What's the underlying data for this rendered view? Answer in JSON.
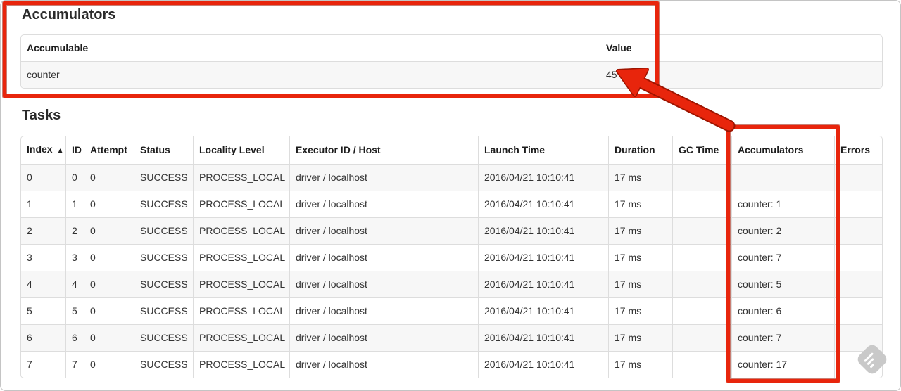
{
  "colors": {
    "annotation_red": "#e8250c",
    "annotation_red_dark": "#9e1400",
    "table_border": "#dddddd",
    "row_stripe": "#f7f7f7",
    "text": "#333333"
  },
  "accumulators_section": {
    "heading": "Accumulators",
    "table": {
      "columns": [
        "Accumulable",
        "Value"
      ],
      "rows": [
        [
          "counter",
          "45"
        ]
      ]
    }
  },
  "tasks_section": {
    "heading": "Tasks",
    "table": {
      "columns": [
        "Index",
        "ID",
        "Attempt",
        "Status",
        "Locality Level",
        "Executor ID / Host",
        "Launch Time",
        "Duration",
        "GC Time",
        "Accumulators",
        "Errors"
      ],
      "sort_column": "Index",
      "sort_indicator": "▲",
      "rows": [
        [
          "0",
          "0",
          "0",
          "SUCCESS",
          "PROCESS_LOCAL",
          "driver / localhost",
          "2016/04/21 10:10:41",
          "17 ms",
          "",
          "",
          ""
        ],
        [
          "1",
          "1",
          "0",
          "SUCCESS",
          "PROCESS_LOCAL",
          "driver / localhost",
          "2016/04/21 10:10:41",
          "17 ms",
          "",
          "counter: 1",
          ""
        ],
        [
          "2",
          "2",
          "0",
          "SUCCESS",
          "PROCESS_LOCAL",
          "driver / localhost",
          "2016/04/21 10:10:41",
          "17 ms",
          "",
          "counter: 2",
          ""
        ],
        [
          "3",
          "3",
          "0",
          "SUCCESS",
          "PROCESS_LOCAL",
          "driver / localhost",
          "2016/04/21 10:10:41",
          "17 ms",
          "",
          "counter: 7",
          ""
        ],
        [
          "4",
          "4",
          "0",
          "SUCCESS",
          "PROCESS_LOCAL",
          "driver / localhost",
          "2016/04/21 10:10:41",
          "17 ms",
          "",
          "counter: 5",
          ""
        ],
        [
          "5",
          "5",
          "0",
          "SUCCESS",
          "PROCESS_LOCAL",
          "driver / localhost",
          "2016/04/21 10:10:41",
          "17 ms",
          "",
          "counter: 6",
          ""
        ],
        [
          "6",
          "6",
          "0",
          "SUCCESS",
          "PROCESS_LOCAL",
          "driver / localhost",
          "2016/04/21 10:10:41",
          "17 ms",
          "",
          "counter: 7",
          ""
        ],
        [
          "7",
          "7",
          "0",
          "SUCCESS",
          "PROCESS_LOCAL",
          "driver / localhost",
          "2016/04/21 10:10:41",
          "17 ms",
          "",
          "counter: 17",
          ""
        ]
      ]
    }
  },
  "annotations": {
    "boxes": [
      "accumulators-section-highlight",
      "accumulators-column-highlight"
    ],
    "arrow_points_to": "45"
  },
  "icons": {
    "sort_ascending": "▲",
    "watermark": "annotation-app-watermark"
  }
}
